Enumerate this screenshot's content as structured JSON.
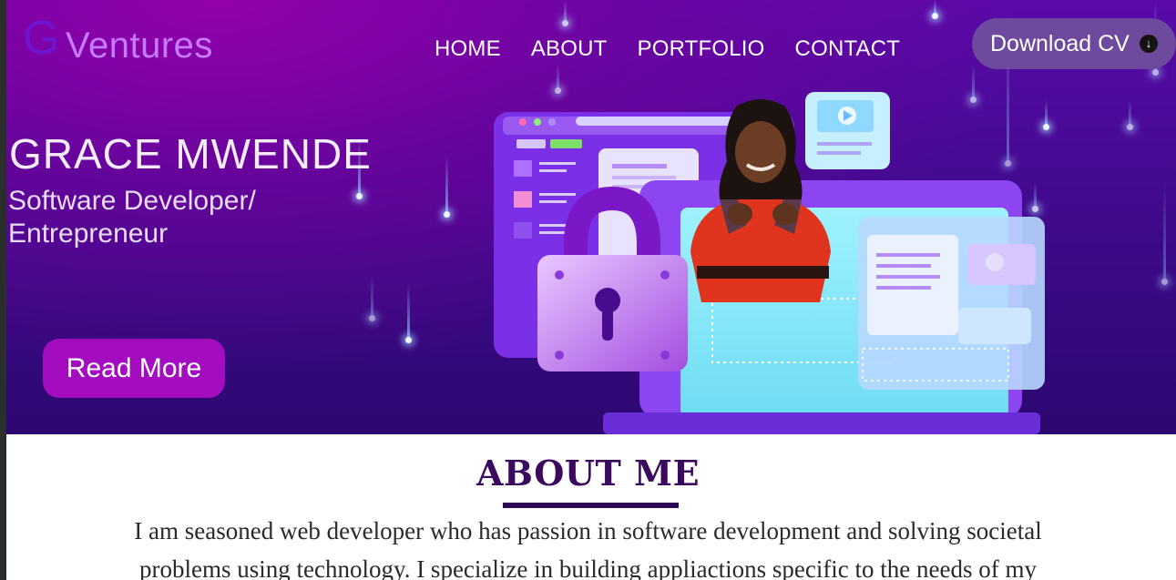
{
  "header": {
    "logo_letter": "G",
    "logo_name": "Ventures",
    "nav": [
      "HOME",
      "ABOUT",
      "PORTFOLIO",
      "CONTACT"
    ],
    "download_label": "Download CV",
    "download_icon": "download-icon"
  },
  "hero": {
    "name": "GRACE MWENDE",
    "role": "Software Developer/ Entrepreneur",
    "read_more": "Read More",
    "illustration": "laptop-padlock-security-illustration",
    "photo": "profile-photo"
  },
  "about": {
    "title": "ABOUT ME",
    "text": "I am seasoned web developer who has passion in software development and solving societal problems using technology. I specialize in building appliactions specific to the needs of my"
  },
  "colors": {
    "hero_top": "#5a0aa8",
    "hero_bottom": "#2c0870",
    "accent": "#a30cbf",
    "about_title": "#3a0a5e"
  }
}
